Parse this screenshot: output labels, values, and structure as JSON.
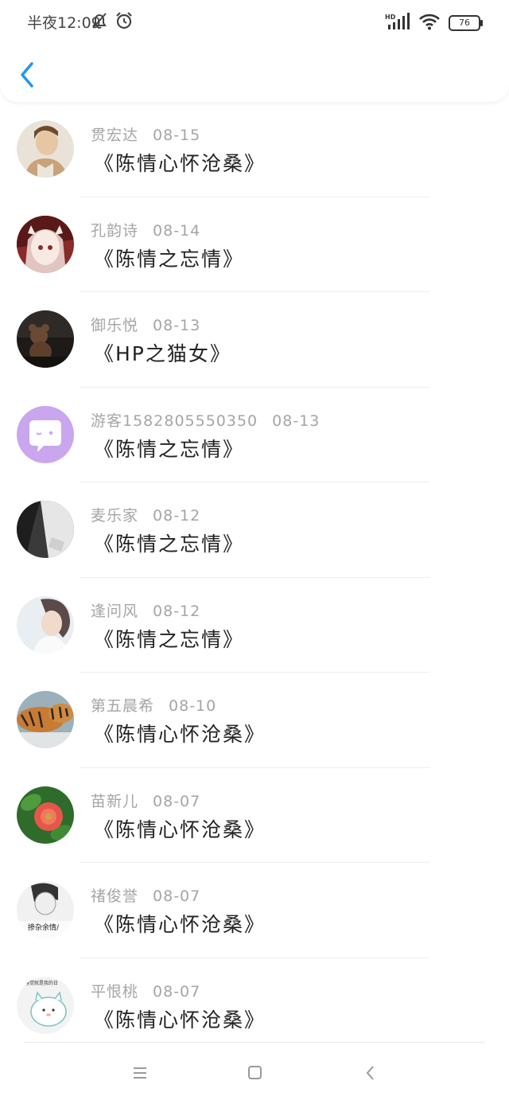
{
  "status": {
    "time": "半夜12:09",
    "battery": "76"
  },
  "header": {
    "back_icon": "chevron-left-icon"
  },
  "items": [
    {
      "name": "贯宏达",
      "date": "08-15",
      "title": "《陈情心怀沧桑》",
      "avatar": {
        "bg": "#c9a27a",
        "fg": "#6b4a2e"
      }
    },
    {
      "name": "孔韵诗",
      "date": "08-14",
      "title": "《陈情之忘情》",
      "avatar": {
        "bg": "#8a2a2a",
        "fg": "#f2e2d8"
      }
    },
    {
      "name": "御乐悦",
      "date": "08-13",
      "title": "《HP之猫女》",
      "avatar": {
        "bg": "#1d1a18",
        "fg": "#6b4a35"
      }
    },
    {
      "name": "游客1582805550350",
      "date": "08-13",
      "title": "《陈情之忘情》",
      "avatar": {
        "bg": "#c9a6ee",
        "fg": "#ffffff"
      }
    },
    {
      "name": "麦乐家",
      "date": "08-12",
      "title": "《陈情之忘情》",
      "avatar": {
        "bg": "#3a3a3a",
        "fg": "#e6e6e6"
      }
    },
    {
      "name": "逢问风",
      "date": "08-12",
      "title": "《陈情之忘情》",
      "avatar": {
        "bg": "#e8eef2",
        "fg": "#5a4a48"
      }
    },
    {
      "name": "第五晨希",
      "date": "08-10",
      "title": "《陈情心怀沧桑》",
      "avatar": {
        "bg": "#c77b35",
        "fg": "#2a2420"
      }
    },
    {
      "name": "苗新儿",
      "date": "08-07",
      "title": "《陈情心怀沧桑》",
      "avatar": {
        "bg": "#2f6b2a",
        "fg": "#e5574a"
      }
    },
    {
      "name": "禇俊誉",
      "date": "08-07",
      "title": "《陈情心怀沧桑》",
      "avatar": {
        "bg": "#f1f1f1",
        "fg": "#333333",
        "caption": "掺杂余情/"
      }
    },
    {
      "name": "平恨桃",
      "date": "08-07",
      "title": "《陈情心怀沧桑》",
      "avatar": {
        "bg": "#f3f3f3",
        "fg": "#7cc3c3",
        "caption": "删睡觉就是我的日"
      }
    }
  ],
  "navbar": {
    "menu_icon": "menu-icon",
    "home_icon": "home-square-icon",
    "back_icon": "back-arrow-icon"
  },
  "colors": {
    "accent": "#2196f3",
    "meta": "#a5a5a5",
    "title": "#222222"
  }
}
